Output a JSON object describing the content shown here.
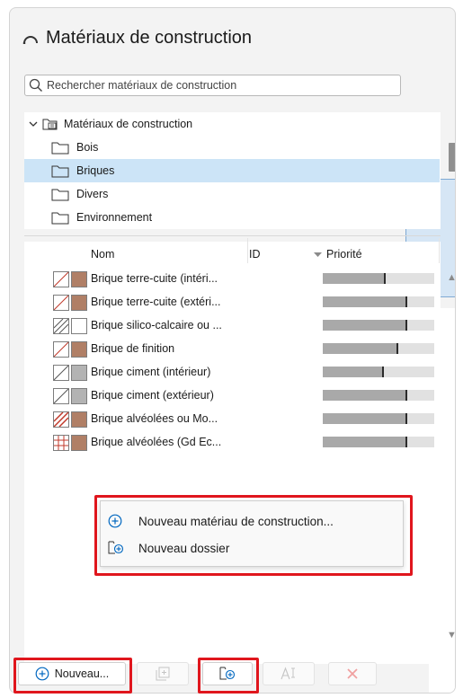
{
  "window": {
    "title": "Matériaux de construction",
    "title_icon": "arc-icon"
  },
  "search": {
    "placeholder": "Rechercher matériaux de construction",
    "view_tree_icon": "tree-view-icon",
    "view_list_icon": "list-view-icon"
  },
  "tree": {
    "root_label": "Matériaux de construction",
    "folders": [
      {
        "label": "Bois",
        "selected": false
      },
      {
        "label": "Briques",
        "selected": true
      },
      {
        "label": "Divers",
        "selected": false
      },
      {
        "label": "Environnement",
        "selected": false
      }
    ]
  },
  "list": {
    "headers": {
      "name": "Nom",
      "id": "ID",
      "priority": "Priorité"
    },
    "rows": [
      {
        "name": "Brique terre-cuite (intéri...",
        "swatch_color": "#b07f66",
        "hatch": "diagonal-red",
        "priority": 0.55
      },
      {
        "name": "Brique terre-cuite (extéri...",
        "swatch_color": "#b07f66",
        "hatch": "diagonal-red",
        "priority": 0.74
      },
      {
        "name": "Brique silico-calcaire ou ...",
        "swatch_color": "#ffffff",
        "hatch": "diagonal-gray",
        "priority": 0.74
      },
      {
        "name": "Brique de finition",
        "swatch_color": "#b07f66",
        "hatch": "diagonal-red",
        "priority": 0.66
      },
      {
        "name": "Brique ciment (intérieur)",
        "swatch_color": "#b3b3b3",
        "hatch": "diagonal-gray",
        "priority": 0.53
      },
      {
        "name": "Brique ciment (extérieur)",
        "swatch_color": "#b3b3b3",
        "hatch": "diagonal-gray",
        "priority": 0.74
      },
      {
        "name": "Brique alvéolées ou Mo...",
        "swatch_color": "#b07f66",
        "hatch": "diagonal-dense-red",
        "priority": 0.74
      },
      {
        "name": "Brique alvéolées (Gd Ec...",
        "swatch_color": "#b07f66",
        "hatch": "grid-red",
        "priority": 0.74
      }
    ]
  },
  "context_menu": {
    "items": [
      {
        "label": "Nouveau matériau de construction...",
        "icon": "add-circle-icon"
      },
      {
        "label": "Nouveau dossier",
        "icon": "new-folder-icon"
      }
    ]
  },
  "bottom_bar": {
    "new_label": "Nouveau...",
    "new_icon": "add-circle-icon",
    "duplicate_icon": "duplicate-icon",
    "new_folder_icon": "new-folder-icon",
    "rename_icon": "rename-icon",
    "delete_icon": "delete-icon"
  },
  "colors": {
    "accent": "#0067c0",
    "selection": "#cce4f7",
    "highlight_frame": "#e0161d",
    "delete_disabled": "#f0a0a0"
  }
}
